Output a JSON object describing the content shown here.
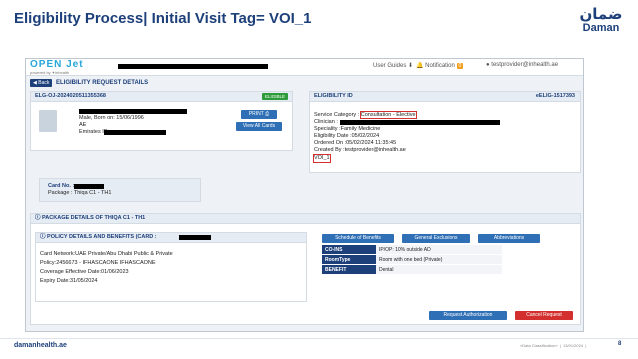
{
  "slide": {
    "title": "Eligibility Process| Initial Visit Tag= VOI_1",
    "logo_ar": "ضمان",
    "logo_en": "Daman",
    "footer_site": "damanhealth.ae",
    "footer_class": "«Data Classification»",
    "footer_date": "13/01/2024",
    "page_number": "8"
  },
  "app": {
    "logo": "OPEN Jet",
    "logo_sub": "powered by ✦inhealth",
    "user_guides": "User Guides",
    "notification_label": "Notification",
    "notification_count": "0",
    "user_email": "testprovider@inhealth.ae"
  },
  "header": {
    "back_label": "Back",
    "page_title": "ELIGIBILITY REQUEST DETAILS"
  },
  "patient": {
    "request_id": "ELG-OJ-2024020511355368",
    "status": "ELIGIBLE",
    "gender_dob": "Male, Born on: 15/06/1996",
    "nationality": "AE",
    "emirates_label": "Emirates ID",
    "print_label": "PRINT",
    "view_cards_label": "View All Cards"
  },
  "eligibility": {
    "id_label": "ELIGIBILITY ID",
    "id_value": "eELIG-1517393",
    "service_category_label": "Service Category :",
    "service_category": "Consultation - Elective",
    "clinician_label": "Clinician :",
    "specialty": "Speciality :Family Medicine",
    "eligibility_date": "Eligibility Date :05/02/2024",
    "ordered_on": "Ordered On :05/02/2024 11:35:45",
    "created_by": "Created By :testprovider@inhealth.ae",
    "tag": "VOI_1"
  },
  "card": {
    "card_no_label": "Card No. :",
    "package": "Package : Thiqa C1 - TH1"
  },
  "package_section": {
    "title": "PACKAGE DETAILS OF THIQA C1 - TH1"
  },
  "policy": {
    "title": "POLICY DETAILS AND BENEFITS (CARD :",
    "card_network": "Card Network:UAE Private/Abu Dhabi Public & Private",
    "policy": "Policy:2456673 - IFHASCAONE IFHASCAONE",
    "coverage": "Coverage Effective Date:01/06/2023",
    "expiry": "Expiry Date:31/05/2024"
  },
  "tabs": {
    "schedule": "Schedule of Benefits",
    "exclusions": "General Exclusions",
    "abbreviations": "Abbreviations"
  },
  "benefits": [
    {
      "key": "CO-INS",
      "value": "IP/OP: 10% outside AD"
    },
    {
      "key": "RoomType",
      "value": "Room with one bed (Private)"
    },
    {
      "key": "BENEFIT",
      "value": "Dental"
    }
  ],
  "actions": {
    "request_auth": "Request Authorization",
    "cancel": "Cancel Request"
  },
  "colors": {
    "brand": "#1d3f7a",
    "button_blue": "#2f6fb5",
    "eligible_green": "#2e9b3a",
    "cancel_red": "#d32f2f"
  }
}
